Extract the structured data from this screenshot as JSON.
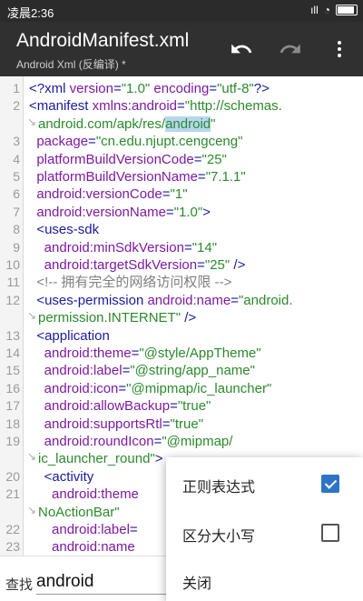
{
  "statusbar": {
    "time": "凌晨2:36",
    "signal": "ıll",
    "wifi": "◔"
  },
  "toolbar": {
    "title": "AndroidManifest.xml",
    "subtitle": "Android Xml (反编译) *",
    "undo_icon": "undo-icon",
    "redo_icon": "redo-icon",
    "more_icon": "more-vert-icon"
  },
  "code": {
    "lines": [
      {
        "n": "1",
        "segs": [
          [
            "tag",
            "<?xml "
          ],
          [
            "attr",
            "version"
          ],
          [
            "tag",
            "="
          ],
          [
            "val",
            "\"1.0\""
          ],
          [
            "tag",
            " "
          ],
          [
            "attr",
            "encoding"
          ],
          [
            "tag",
            "="
          ],
          [
            "val",
            "\"utf-8\""
          ],
          [
            "tag",
            "?>"
          ]
        ]
      },
      {
        "n": "2",
        "segs": [
          [
            "tag",
            "<manifest "
          ],
          [
            "attr",
            "xmlns:android"
          ],
          [
            "tag",
            "="
          ],
          [
            "val",
            "\"http://schemas."
          ]
        ]
      },
      {
        "n": "",
        "wrap": true,
        "segs": [
          [
            "val",
            "android.com/apk/res/"
          ],
          [
            "hl",
            "android"
          ],
          [
            "val",
            "\""
          ]
        ]
      },
      {
        "n": "3",
        "segs": [
          [
            "attr",
            "  package"
          ],
          [
            "tag",
            "="
          ],
          [
            "val",
            "\"cn.edu.njupt.cengceng\""
          ]
        ]
      },
      {
        "n": "4",
        "segs": [
          [
            "attr",
            "  platformBuildVersionCode"
          ],
          [
            "tag",
            "="
          ],
          [
            "val",
            "\"25\""
          ]
        ]
      },
      {
        "n": "5",
        "segs": [
          [
            "attr",
            "  platformBuildVersionName"
          ],
          [
            "tag",
            "="
          ],
          [
            "val",
            "\"7.1.1\""
          ]
        ]
      },
      {
        "n": "6",
        "segs": [
          [
            "attr",
            "  android:versionCode"
          ],
          [
            "tag",
            "="
          ],
          [
            "val",
            "\"1\""
          ]
        ]
      },
      {
        "n": "7",
        "segs": [
          [
            "attr",
            "  android:versionName"
          ],
          [
            "tag",
            "="
          ],
          [
            "val",
            "\"1.0\""
          ],
          [
            "tag",
            ">"
          ]
        ]
      },
      {
        "n": "8",
        "segs": [
          [
            "tag",
            "  <uses-sdk"
          ]
        ]
      },
      {
        "n": "9",
        "segs": [
          [
            "attr",
            "    android:minSdkVersion"
          ],
          [
            "tag",
            "="
          ],
          [
            "val",
            "\"14\""
          ]
        ]
      },
      {
        "n": "10",
        "segs": [
          [
            "attr",
            "    android:targetSdkVersion"
          ],
          [
            "tag",
            "="
          ],
          [
            "val",
            "\"25\""
          ],
          [
            "tag",
            " />"
          ]
        ]
      },
      {
        "n": "11",
        "segs": [
          [
            "cmt",
            "  <!-- 拥有完全的网络访问权限 -->"
          ]
        ]
      },
      {
        "n": "12",
        "segs": [
          [
            "tag",
            "  <uses-permission "
          ],
          [
            "attr",
            "android:name"
          ],
          [
            "tag",
            "="
          ],
          [
            "val",
            "\"android."
          ]
        ]
      },
      {
        "n": "",
        "wrap": true,
        "segs": [
          [
            "val",
            "permission.INTERNET\""
          ],
          [
            "tag",
            " />"
          ]
        ]
      },
      {
        "n": "13",
        "segs": [
          [
            "tag",
            "  <application"
          ]
        ]
      },
      {
        "n": "14",
        "segs": [
          [
            "attr",
            "    android:theme"
          ],
          [
            "tag",
            "="
          ],
          [
            "val",
            "\"@style/AppTheme\""
          ]
        ]
      },
      {
        "n": "15",
        "segs": [
          [
            "attr",
            "    android:label"
          ],
          [
            "tag",
            "="
          ],
          [
            "val",
            "\"@string/app_name\""
          ]
        ]
      },
      {
        "n": "16",
        "segs": [
          [
            "attr",
            "    android:icon"
          ],
          [
            "tag",
            "="
          ],
          [
            "val",
            "\"@mipmap/ic_launcher\""
          ]
        ]
      },
      {
        "n": "17",
        "segs": [
          [
            "attr",
            "    android:allowBackup"
          ],
          [
            "tag",
            "="
          ],
          [
            "val",
            "\"true\""
          ]
        ]
      },
      {
        "n": "18",
        "segs": [
          [
            "attr",
            "    android:supportsRtl"
          ],
          [
            "tag",
            "="
          ],
          [
            "val",
            "\"true\""
          ]
        ]
      },
      {
        "n": "19",
        "segs": [
          [
            "attr",
            "    android:roundIcon"
          ],
          [
            "tag",
            "="
          ],
          [
            "val",
            "\"@mipmap/"
          ]
        ]
      },
      {
        "n": "",
        "wrap": true,
        "segs": [
          [
            "val",
            "ic_launcher_round\""
          ],
          [
            "tag",
            ">"
          ]
        ]
      },
      {
        "n": "20",
        "segs": [
          [
            "tag",
            "    <activity"
          ]
        ]
      },
      {
        "n": "21",
        "segs": [
          [
            "attr",
            "      android:theme"
          ]
        ]
      },
      {
        "n": "",
        "wrap": true,
        "segs": [
          [
            "val",
            "NoActionBar\""
          ]
        ]
      },
      {
        "n": "22",
        "segs": [
          [
            "attr",
            "      android:label"
          ],
          [
            "tag",
            "="
          ]
        ]
      },
      {
        "n": "23",
        "segs": [
          [
            "attr",
            "      android:name"
          ]
        ]
      }
    ]
  },
  "findbar": {
    "label": "查找",
    "value": "android"
  },
  "menu": {
    "items": [
      {
        "label": "正则表达式",
        "checked": true
      },
      {
        "label": "区分大小写",
        "checked": false
      },
      {
        "label": "关闭"
      }
    ]
  },
  "colors": {
    "tag": "#1a1a9e",
    "attribute": "#7d1aa0",
    "value": "#2b8a2b",
    "comment": "#808080",
    "highlight": "#b7d7f0",
    "toolbar": "#303030",
    "checkbox_accent": "#2e74c6"
  }
}
